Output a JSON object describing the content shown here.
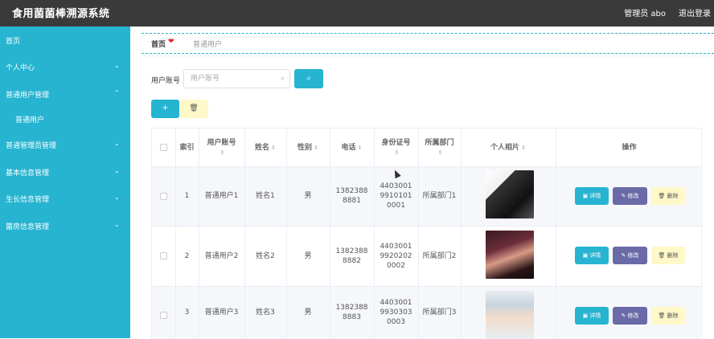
{
  "app": {
    "title": "食用菌菌棒溯源系统",
    "admin": "管理员 abo",
    "logout": "退出登录"
  },
  "sidebar": {
    "items": [
      {
        "label": "首页",
        "chevron": ""
      },
      {
        "label": "个人中心",
        "chevron": "⌄"
      },
      {
        "label": "普通用户管理",
        "chevron": "⌃"
      },
      {
        "label": "普通用户",
        "chevron": ""
      },
      {
        "label": "普通管理员管理",
        "chevron": "⌄"
      },
      {
        "label": "基本信息管理",
        "chevron": "⌄"
      },
      {
        "label": "生长信息管理",
        "chevron": "⌄"
      },
      {
        "label": "菌房信息管理",
        "chevron": "⌄"
      }
    ]
  },
  "breadcrumb": {
    "home": "首页",
    "separator": "❤",
    "current": "普通用户"
  },
  "search": {
    "label": "用户账号",
    "placeholder": "用户账号",
    "search_icon": "search-icon"
  },
  "toolbar": {
    "add_icon": "+",
    "delete_icon": "trash-icon"
  },
  "table": {
    "headers": [
      "索引",
      "用户账号",
      "姓名",
      "性别",
      "电话",
      "身份证号",
      "所属部门",
      "个人相片",
      "操作"
    ],
    "sort_icon": "⇕",
    "rows": [
      {
        "index": "1",
        "account": "普通用户1",
        "name": "姓名1",
        "gender": "男",
        "phone": "13823888881",
        "id_no": "440300199101010001",
        "dept": "所属部门1"
      },
      {
        "index": "2",
        "account": "普通用户2",
        "name": "姓名2",
        "gender": "男",
        "phone": "13823888882",
        "id_no": "440300199202020002",
        "dept": "所属部门2"
      },
      {
        "index": "3",
        "account": "普通用户3",
        "name": "姓名3",
        "gender": "男",
        "phone": "13823888883",
        "id_no": "440300199303030003",
        "dept": "所属部门3"
      }
    ],
    "actions": {
      "detail": "详情",
      "edit": "修改",
      "delete": "删除"
    }
  },
  "colors": {
    "accent": "#26b4d1",
    "topbar": "#3a3a3a",
    "edit": "#6a6aa8",
    "delete": "#fff8c8"
  }
}
